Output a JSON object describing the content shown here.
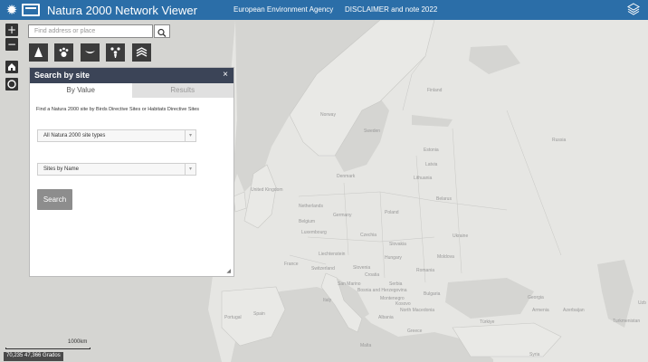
{
  "header": {
    "title": "Natura 2000 Network Viewer",
    "agency_link": "European Environment Agency",
    "disclaimer_link": "DISCLAIMER and note 2022",
    "bg_color": "#2b6ea8"
  },
  "search": {
    "placeholder": "Find address or place",
    "icon": "search-icon"
  },
  "controls": {
    "zoom_in": "+",
    "zoom_out": "−"
  },
  "toolbar": {
    "tools": [
      {
        "icon": "tree-icon"
      },
      {
        "icon": "paw-icon"
      },
      {
        "icon": "bird-icon"
      },
      {
        "icon": "habitat-icon"
      },
      {
        "icon": "waves-icon"
      }
    ]
  },
  "panel": {
    "title": "Search by site",
    "close": "×",
    "tabs": [
      "By Value",
      "Results"
    ],
    "description": "Find a Natura 2000 site by Birds Directive Sites or Habitats Directive Sites",
    "select1": "All Natura 2000 site types",
    "select2": "Sites by Name",
    "search_button": "Search",
    "header_color": "#3b4457"
  },
  "map": {
    "countries": [
      "Finland",
      "Norway",
      "Sweden",
      "Estonia",
      "Latvia",
      "Lithuania",
      "Belarus",
      "Denmark",
      "United Kingdom",
      "Netherlands",
      "Germany",
      "Poland",
      "Belgium",
      "Luxembourg",
      "Czechia",
      "Slovakia",
      "Ukraine",
      "Liechtenstein",
      "Hungary",
      "Moldova",
      "France",
      "Switzerland",
      "Slovenia",
      "Croatia",
      "Romania",
      "San Marino",
      "Bosnia and Herzegovina",
      "Serbia",
      "Italy",
      "Montenegro",
      "Bulgaria",
      "Kosovo",
      "North Macedonia",
      "Albania",
      "Spain",
      "Portugal",
      "Greece",
      "Türkiye",
      "Georgia",
      "Armenia",
      "Azerbaijan",
      "Turkmenistan",
      "Russia",
      "Malta",
      "Syria",
      "Uzb"
    ]
  },
  "scale": {
    "label": "1000km",
    "coords": "70,235 47,366 Grados"
  }
}
